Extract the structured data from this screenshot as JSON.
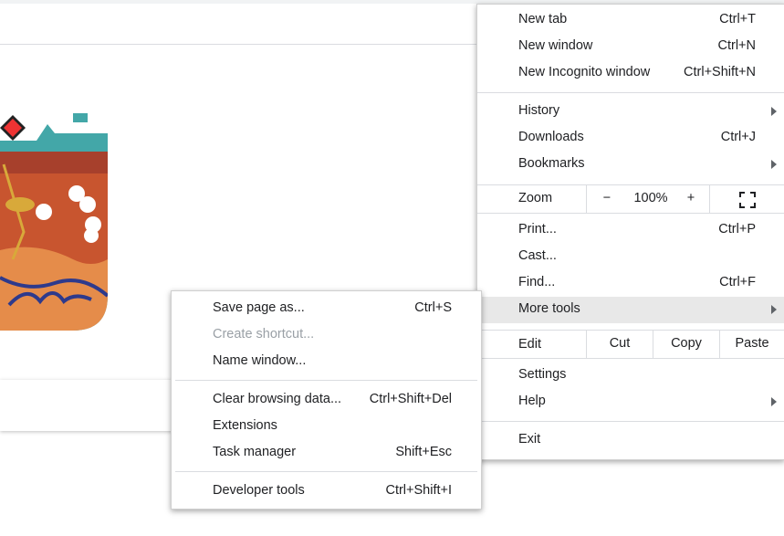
{
  "main_menu": {
    "items_top": [
      {
        "label": "New tab",
        "shortcut": "Ctrl+T"
      },
      {
        "label": "New window",
        "shortcut": "Ctrl+N"
      },
      {
        "label": "New Incognito window",
        "shortcut": "Ctrl+Shift+N"
      }
    ],
    "items_mid": [
      {
        "label": "History",
        "shortcut": ""
      },
      {
        "label": "Downloads",
        "shortcut": "Ctrl+J"
      },
      {
        "label": "Bookmarks",
        "shortcut": ""
      }
    ],
    "zoom": {
      "label": "Zoom",
      "minus": "−",
      "value": "100%",
      "plus": "+"
    },
    "items_tools": [
      {
        "label": "Print...",
        "shortcut": "Ctrl+P"
      },
      {
        "label": "Cast...",
        "shortcut": ""
      },
      {
        "label": "Find...",
        "shortcut": "Ctrl+F"
      },
      {
        "label": "More tools",
        "shortcut": ""
      }
    ],
    "edit": {
      "label": "Edit",
      "cut": "Cut",
      "copy": "Copy",
      "paste": "Paste"
    },
    "items_settings": [
      {
        "label": "Settings"
      },
      {
        "label": "Help"
      }
    ],
    "exit": "Exit"
  },
  "sub_menu": {
    "items": [
      {
        "label": "Save page as...",
        "shortcut": "Ctrl+S"
      },
      {
        "label": "Create shortcut...",
        "shortcut": ""
      },
      {
        "label": "Name window...",
        "shortcut": ""
      },
      {
        "label": "Clear browsing data...",
        "shortcut": "Ctrl+Shift+Del"
      },
      {
        "label": "Extensions",
        "shortcut": ""
      },
      {
        "label": "Task manager",
        "shortcut": "Shift+Esc"
      },
      {
        "label": "Developer tools",
        "shortcut": "Ctrl+Shift+I"
      }
    ]
  }
}
